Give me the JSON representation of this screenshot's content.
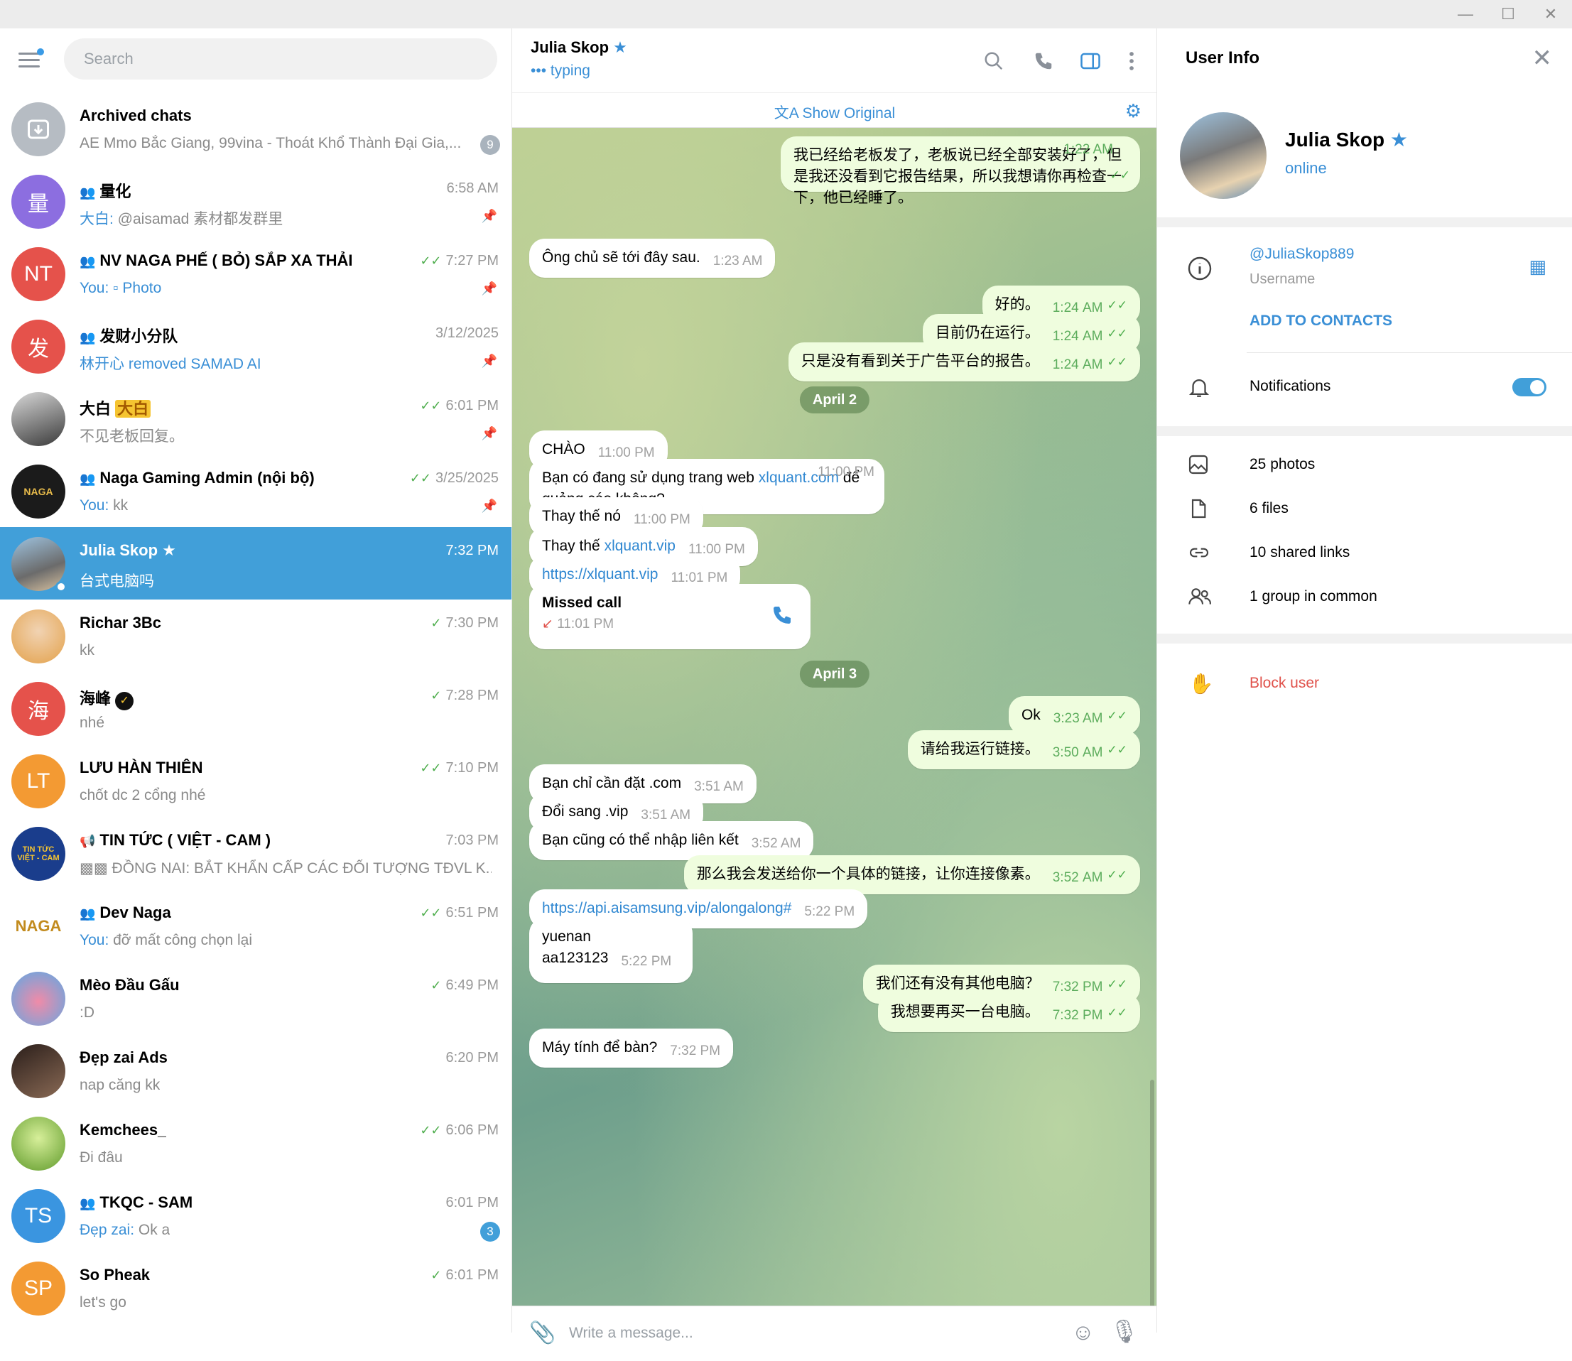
{
  "window": {
    "minimize": "—",
    "maximize": "☐",
    "close": "✕"
  },
  "sidebar": {
    "search_placeholder": "Search",
    "chats": [
      {
        "name": "Archived chats",
        "time": "",
        "sender": "",
        "preview": "AE Mmo Bắc Giang, 99vina - Thoát Khổ Thành Đại Gia,...",
        "badge": "9",
        "avatar_text": "",
        "avatar_color": "#b6bcc3"
      },
      {
        "name": "量化",
        "time": "6:58 AM",
        "sender": "大白: ",
        "preview": "@aisamad 素材都发群里",
        "badge": "",
        "avatar_text": "量",
        "avatar_color": "#8c6ee0"
      },
      {
        "name": "NV NAGA PHẾ ( BỎ) SẮP XA THẢI",
        "time": "7:27 PM",
        "sender": "You: ",
        "preview": "Photo",
        "badge": "",
        "avatar_text": "NT",
        "avatar_color": "#e5524b"
      },
      {
        "name": "发财小分队",
        "time": "3/12/2025",
        "sender": "",
        "preview": "林开心 removed SAMAD AI",
        "badge": "",
        "avatar_text": "发",
        "avatar_color": "#e5524b"
      },
      {
        "name": "大白 ",
        "name_tag": "大白",
        "time": "6:01 PM",
        "sender": "",
        "preview": "不见老板回复。",
        "badge": "",
        "avatar_text": "",
        "avatar_color": "#4a4a4a"
      },
      {
        "name": "Naga Gaming Admin (nội bộ)",
        "time": "3/25/2025",
        "sender": "You: ",
        "preview": "kk",
        "badge": "",
        "avatar_text": "NAGA",
        "avatar_color": "#1b1b1b"
      },
      {
        "name": "Julia Skop",
        "time": "7:32 PM",
        "sender": "",
        "preview": "台式电脑吗",
        "badge": "",
        "avatar_text": "",
        "avatar_color": "#6b8fb0"
      },
      {
        "name": "Richar 3Bc",
        "time": "7:30 PM",
        "sender": "",
        "preview": "kk",
        "badge": "",
        "avatar_text": "",
        "avatar_color": "#e3a14a"
      },
      {
        "name": "海峰",
        "time": "7:28 PM",
        "sender": "",
        "preview": "nhé",
        "badge": "",
        "avatar_text": "海",
        "avatar_color": "#e5524b"
      },
      {
        "name": "LƯU HÀN THIÊN",
        "time": "7:10 PM",
        "sender": "",
        "preview": "chốt dc 2 cổng nhé",
        "badge": "",
        "avatar_text": "LT",
        "avatar_color": "#f39a33"
      },
      {
        "name": "TIN TỨC ( VIỆT - CAM )",
        "time": "7:03 PM",
        "sender": "",
        "preview": "ĐỒNG NAI: BẮT KHẨN CẤP CÁC ĐỐI TƯỢNG TĐVL K...",
        "badge": "",
        "avatar_text": "TIN TỨC VIỆT - CAM",
        "avatar_color": "#1a3d8c"
      },
      {
        "name": "Dev Naga",
        "time": "6:51 PM",
        "sender": "You: ",
        "preview": "đỡ mất công chọn lại",
        "badge": "",
        "avatar_text": "NAGA",
        "avatar_color": "#ffffff"
      },
      {
        "name": "Mèo Đầu Gấu",
        "time": "6:49 PM",
        "sender": "",
        "preview": ":D",
        "badge": "",
        "avatar_text": "",
        "avatar_color": "#5aa9e6"
      },
      {
        "name": "Đẹp zai Ads",
        "time": "6:20 PM",
        "sender": "",
        "preview": "nap căng kk",
        "badge": "",
        "avatar_text": "",
        "avatar_color": "#5b3b2f"
      },
      {
        "name": "Kemchees_",
        "time": "6:06 PM",
        "sender": "",
        "preview": "Đi đâu",
        "badge": "",
        "avatar_text": "",
        "avatar_color": "#7fb23a"
      },
      {
        "name": "TKQC - SAM",
        "time": "6:01 PM",
        "sender": "Đẹp zai: ",
        "preview": "Ok a",
        "badge": "3",
        "avatar_text": "TS",
        "avatar_color": "#3a95e0"
      },
      {
        "name": "So Pheak",
        "time": "6:01 PM",
        "sender": "",
        "preview": "let's go",
        "badge": "",
        "avatar_text": "SP",
        "avatar_color": "#f39a33"
      }
    ]
  },
  "conversation": {
    "name": "Julia Skop",
    "status": "typing",
    "translate_label": "Show Original",
    "input_placeholder": "Write a message...",
    "messages": [
      {
        "dir": "out",
        "text": "我已经给老板发了，老板说已经全部安装好了，但是我还没看到它报告结果，所以我想请你再检查一下，他已经睡了。",
        "time": "1:22 AM"
      },
      {
        "dir": "in",
        "text": "Ông chủ sẽ tới đây sau.",
        "time": "1:23 AM"
      },
      {
        "dir": "out",
        "text": "好的。",
        "time": "1:24 AM"
      },
      {
        "dir": "out",
        "text": "目前仍在运行。",
        "time": "1:24 AM"
      },
      {
        "dir": "out",
        "text": "只是没有看到关于广告平台的报告。",
        "time": "1:24 AM"
      },
      {
        "dir": "date",
        "text": "April 2"
      },
      {
        "dir": "in",
        "text": "CHÀO",
        "time": "11:00 PM"
      },
      {
        "dir": "in",
        "text_a": "Bạn có đang sử dụng trang web ",
        "link": "xlquant.com",
        "text_b": " để quảng cáo không?",
        "time": "11:00 PM"
      },
      {
        "dir": "in",
        "text": "Thay thế nó",
        "time": "11:00 PM"
      },
      {
        "dir": "in",
        "text_a": "Thay thế ",
        "link": "xlquant.vip",
        "time": "11:00 PM"
      },
      {
        "dir": "in",
        "link": "https://xlquant.vip",
        "time": "11:01 PM"
      },
      {
        "dir": "call",
        "text": "Missed call",
        "time": "11:01 PM"
      },
      {
        "dir": "date",
        "text": "April 3"
      },
      {
        "dir": "out",
        "text": "Ok",
        "time": "3:23 AM"
      },
      {
        "dir": "out",
        "text": "请给我运行链接。",
        "time": "3:50 AM"
      },
      {
        "dir": "in",
        "text": "Bạn chỉ cần đặt .com",
        "time": "3:51 AM"
      },
      {
        "dir": "in",
        "text": "Đổi sang .vip",
        "time": "3:51 AM"
      },
      {
        "dir": "in",
        "text": "Bạn cũng có thể nhập liên kết",
        "time": "3:52 AM"
      },
      {
        "dir": "out",
        "text": "那么我会发送给你一个具体的链接，让你连接像素。",
        "time": "3:52 AM"
      },
      {
        "dir": "in",
        "link": "https://api.aisamsung.vip/alongalong#",
        "time": "5:22 PM"
      },
      {
        "dir": "in",
        "text_a": "yuenan",
        "text_b": "aa123123",
        "time": "5:22 PM"
      },
      {
        "dir": "out",
        "text": "我们还有没有其他电脑？",
        "time": "7:32 PM"
      },
      {
        "dir": "out",
        "text": "我想要再买一台电脑。",
        "time": "7:32 PM"
      },
      {
        "dir": "in",
        "text": "Máy tính để bàn?",
        "time": "7:32 PM"
      }
    ]
  },
  "user_info": {
    "title": "User Info",
    "name": "Julia Skop",
    "status": "online",
    "username": "@JuliaSkop889",
    "username_label": "Username",
    "add_contact": "ADD TO CONTACTS",
    "notifications": "Notifications",
    "notifications_on": true,
    "photos": "25 photos",
    "files": "6 files",
    "links": "10 shared links",
    "groups": "1 group in common",
    "block": "Block user"
  },
  "colors": {
    "accent": "#419fd9",
    "out_bubble": "#effdde",
    "danger": "#e0524b",
    "tick": "#4fae4e"
  }
}
